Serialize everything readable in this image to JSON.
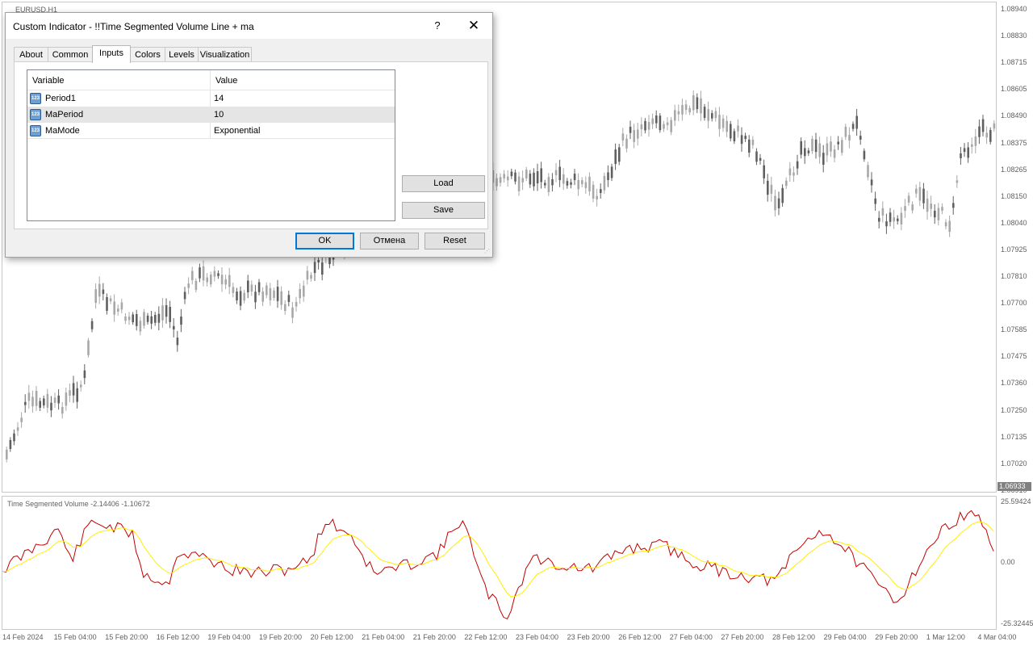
{
  "main_chart": {
    "symbol_label": "EURUSD,H1",
    "price_labels": [
      "1.08940",
      "1.08830",
      "1.08715",
      "1.08605",
      "1.08490",
      "1.08375",
      "1.08265",
      "1.08150",
      "1.08040",
      "1.07925",
      "1.07810",
      "1.07700",
      "1.07585",
      "1.07475",
      "1.07360",
      "1.07250",
      "1.07135",
      "1.07020",
      "1.06910"
    ],
    "current_price": "1.06933",
    "candle_color": "#a8a8a8",
    "candle_color_dark": "#606060"
  },
  "indicator_panel": {
    "label": "Time Segmented Volume -2.14406 -1.10672",
    "scale_labels": [
      "25.59424",
      "0.00",
      "-25.32445"
    ],
    "tsv_color": "#c00000",
    "ma_color": "#ffee00"
  },
  "time_axis": [
    "14 Feb 2024",
    "15 Feb 04:00",
    "15 Feb 20:00",
    "16 Feb 12:00",
    "19 Feb 04:00",
    "19 Feb 20:00",
    "20 Feb 12:00",
    "21 Feb 04:00",
    "21 Feb 20:00",
    "22 Feb 12:00",
    "23 Feb 04:00",
    "23 Feb 20:00",
    "26 Feb 12:00",
    "27 Feb 04:00",
    "27 Feb 20:00",
    "28 Feb 12:00",
    "29 Feb 04:00",
    "29 Feb 20:00",
    "1 Mar 12:00",
    "4 Mar 04:00"
  ],
  "dialog": {
    "title": "Custom Indicator - !!Time Segmented Volume Line + ma",
    "help": "?",
    "close": "✕",
    "tabs": [
      "About",
      "Common",
      "Inputs",
      "Colors",
      "Levels",
      "Visualization"
    ],
    "active_tab": "Inputs",
    "columns": [
      "Variable",
      "Value"
    ],
    "icon_text": "123",
    "params": [
      {
        "name": "Period1",
        "value": "14"
      },
      {
        "name": "MaPeriod",
        "value": "10"
      },
      {
        "name": "MaMode",
        "value": "Exponential"
      }
    ],
    "selected_row": 1,
    "load_label": "Load",
    "save_label": "Save",
    "ok_label": "OK",
    "cancel_label": "Отмена",
    "reset_label": "Reset",
    "accent_color": "#0078d7"
  }
}
